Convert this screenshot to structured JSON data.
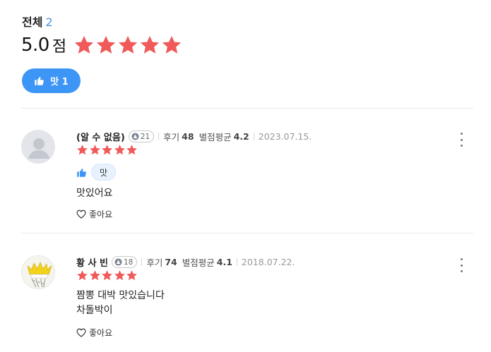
{
  "summary": {
    "total_label": "전체",
    "total_count": "2",
    "score": "5.0",
    "score_unit": "점",
    "rating": 5
  },
  "filter": {
    "label": "맛 1"
  },
  "reviews": [
    {
      "nickname": "(알 수 없음)",
      "level": "21",
      "review_label": "후기",
      "review_count": "48",
      "avg_label": "별점평균",
      "avg_value": "4.2",
      "date": "2023.07.15.",
      "rating": 5,
      "tag": "맛",
      "lines": [
        "맛있어요"
      ],
      "like_label": "좋아요",
      "avatar": "default-avatar"
    },
    {
      "nickname": "황 사 빈",
      "level": "18",
      "review_label": "후기",
      "review_count": "74",
      "avg_label": "별점평균",
      "avg_value": "4.1",
      "date": "2018.07.22.",
      "rating": 5,
      "lines": [
        "짬뽕 대박 맛있습니다",
        "차돌박이"
      ],
      "like_label": "좋아요",
      "avatar": "custom-photo"
    }
  ],
  "colors": {
    "star": "#f05a5a",
    "accent": "#3d95f6",
    "count": "#4a90e2"
  }
}
